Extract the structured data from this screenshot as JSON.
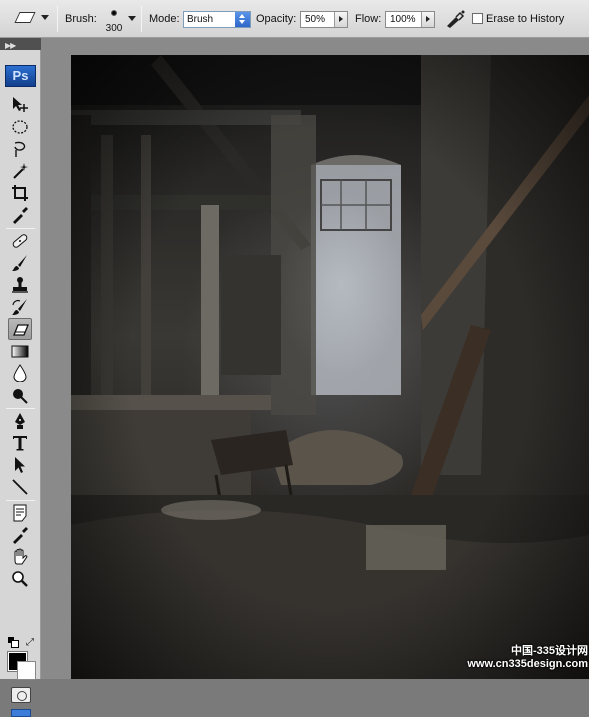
{
  "options_bar": {
    "tool_preset_icon": "eraser-icon",
    "brush_label": "Brush:",
    "brush_size": "300",
    "mode_label": "Mode:",
    "mode_value": "Brush",
    "opacity_label": "Opacity:",
    "opacity_value": "50%",
    "flow_label": "Flow:",
    "flow_value": "100%",
    "airbrush_icon": "airbrush-icon",
    "erase_to_history_label": "Erase to History",
    "erase_to_history_checked": false
  },
  "tools_panel": {
    "logo": "Ps",
    "tools": [
      {
        "name": "move-tool",
        "icon": "move-icon"
      },
      {
        "name": "marquee-tool",
        "icon": "elliptical-marquee-icon"
      },
      {
        "name": "lasso-tool",
        "icon": "lasso-icon"
      },
      {
        "name": "magic-wand-tool",
        "icon": "magic-wand-icon"
      },
      {
        "name": "crop-tool",
        "icon": "crop-icon"
      },
      {
        "name": "eyedropper-tool",
        "icon": "eyedropper-icon"
      },
      {
        "name": "healing-brush-tool",
        "icon": "bandage-icon"
      },
      {
        "name": "brush-tool",
        "icon": "brush-icon"
      },
      {
        "name": "clone-stamp-tool",
        "icon": "stamp-icon"
      },
      {
        "name": "history-brush-tool",
        "icon": "history-brush-icon"
      },
      {
        "name": "eraser-tool",
        "icon": "eraser-icon",
        "selected": true
      },
      {
        "name": "gradient-tool",
        "icon": "gradient-icon"
      },
      {
        "name": "blur-tool",
        "icon": "blur-icon"
      },
      {
        "name": "dodge-tool",
        "icon": "dodge-icon"
      },
      {
        "name": "pen-tool",
        "icon": "pen-icon"
      },
      {
        "name": "type-tool",
        "icon": "type-icon",
        "glyph": "T"
      },
      {
        "name": "path-selection-tool",
        "icon": "path-selection-icon"
      },
      {
        "name": "line-tool",
        "icon": "line-icon"
      },
      {
        "name": "notes-tool",
        "icon": "notes-icon"
      },
      {
        "name": "eyedropper-tool-2",
        "icon": "eyedropper-icon"
      },
      {
        "name": "hand-tool",
        "icon": "hand-icon"
      },
      {
        "name": "zoom-tool",
        "icon": "zoom-icon"
      }
    ],
    "foreground_color": "#000000",
    "background_color": "#ffffff"
  },
  "canvas": {
    "description_icon": "abandoned-factory-image"
  },
  "watermark": {
    "line1": "中国-335设计网",
    "line2": "www.cn335design.com"
  }
}
